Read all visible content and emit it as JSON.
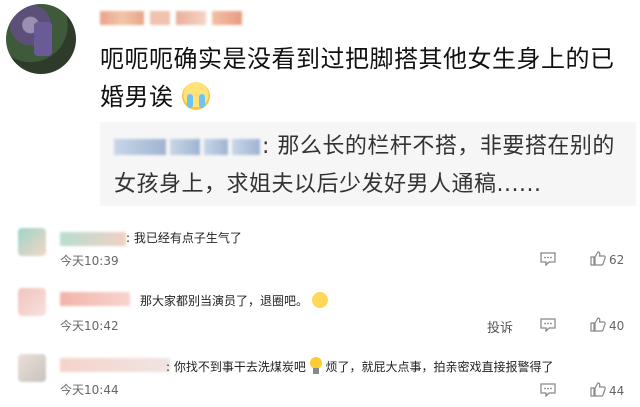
{
  "main_comment": {
    "text": "呃呃呃确实是没看到过把脚搭其他女生身上的已婚男诶",
    "emoji": "crying-face"
  },
  "quoted_comment": {
    "text": ": 那么长的栏杆不搭，非要搭在别的女孩身上，求姐夫以后少发好男人通稿......"
  },
  "replies": [
    {
      "text": ": 我已经有点子生气了",
      "time": "今天10:39",
      "likes": "62",
      "has_report": false,
      "trailing_emoji": null
    },
    {
      "text": "那大家都别当演员了，退圈吧。",
      "time": "今天10:42",
      "likes": "40",
      "has_report": true,
      "report_label": "投诉",
      "trailing_emoji": "laughing-face"
    },
    {
      "text_part1": ": 你找不到事干去洗煤炭吧",
      "text_part2": "烦了，就屁大点事，拍亲密戏直接报警得了",
      "time": "今天10:44",
      "likes": "44",
      "has_report": false
    }
  ],
  "colors": {
    "time": "#666666",
    "icon": "#888888",
    "quote_bg": "#f6f6f6"
  }
}
